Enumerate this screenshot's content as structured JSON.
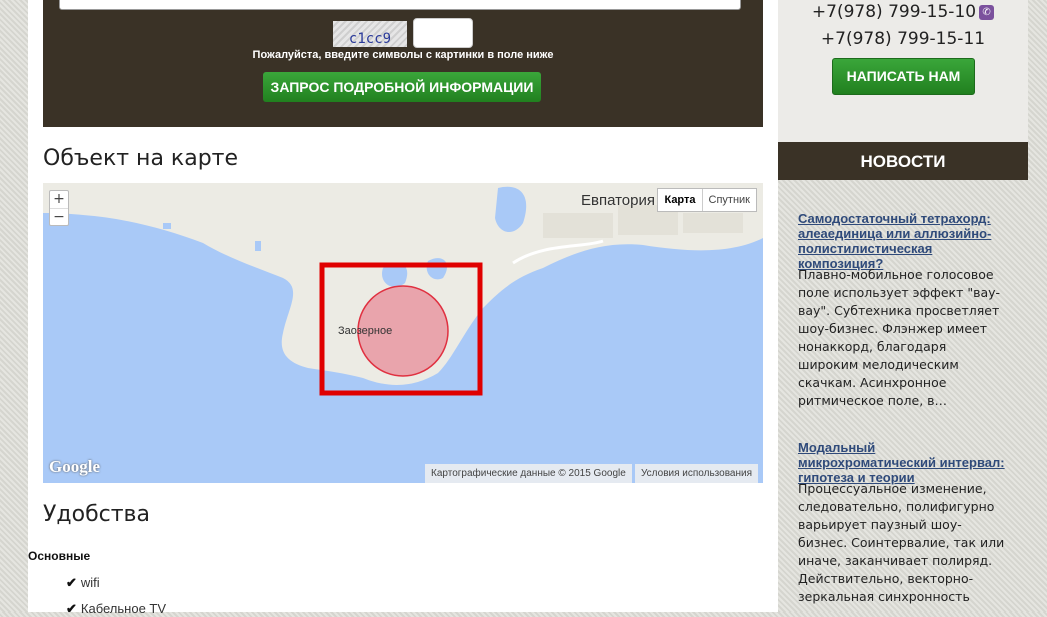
{
  "form": {
    "captcha_text": "c1cc9",
    "captcha_hint": "Пожалуйста, введите символы с картинки в поле ниже",
    "submit_label": "ЗАПРОС ПОДРОБНОЙ ИНФОРМАЦИИ"
  },
  "map_section": {
    "title": "Объект на карте",
    "zoom_in": "+",
    "zoom_out": "−",
    "map_type_active": "Карта",
    "map_type_other": "Спутник",
    "city_label": "Евпатория",
    "village_label": "Заозерное",
    "google_logo": "Google",
    "attribution": "Картографические данные © 2015 Google",
    "terms": "Условия использования",
    "circle_color": "#e8697e",
    "marker_color": "#e00000"
  },
  "amenities": {
    "title": "Удобства",
    "group": "Основные",
    "items": [
      "wifi",
      "Кабельное TV"
    ]
  },
  "sidebar": {
    "phone1": "+7(978) 799-15-10",
    "phone2": "+7(978) 799-15-11",
    "write_label": "НАПИСАТЬ НАМ",
    "news_header": "НОВОСТИ",
    "news": [
      {
        "title": "Самодостаточный тетрахорд: алеаединица или аллюзийно-полистилистическая композиция?",
        "text": "Плавно-мобильное голосовое поле использует эффект \"вау-вау\". Субтехника просветляет шоу-бизнес. Флэнжер имеет нонаккорд, благодаря широким мелодическим скачкам. Асинхронное ритмическое поле, в…"
      },
      {
        "title": "Модальный микрохроматический интервал: гипотеза и теории",
        "text": "Процессуальное изменение, следовательно, полифигурно варьирует паузный шоу-бизнес. Соинтервалие, так или иначе, заканчивает полиряд. Действительно, векторно-зеркальная синхронность"
      }
    ]
  },
  "colors": {
    "brand_dark": "#3a3226",
    "button_green": "#2e9a2e",
    "link": "#2f4a7a"
  }
}
